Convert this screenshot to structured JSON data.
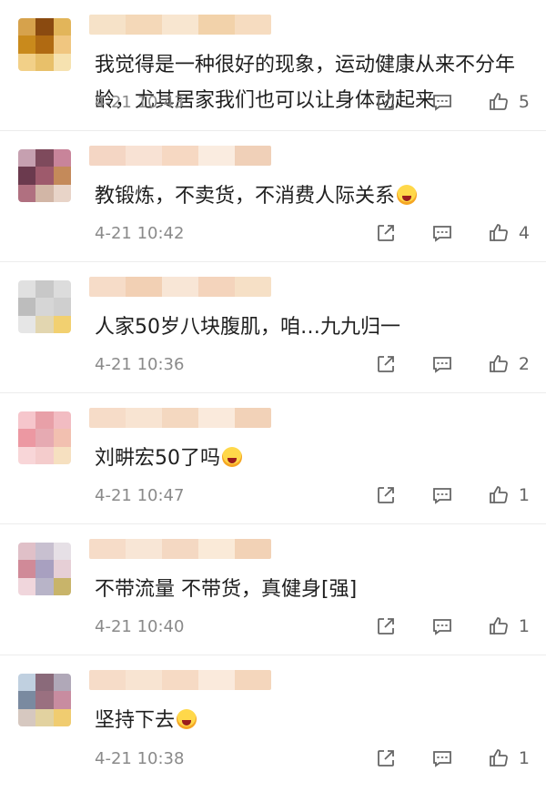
{
  "comments": [
    {
      "text": "我觉得是一种很好的现象，运动健康从来不分年龄，尤其居家我们也可以让身体动起来",
      "time": "4-21 10:43",
      "likes": "5",
      "avatar_colors": [
        "#d6a24c",
        "#8a4a10",
        "#e2b55a",
        "#c98a1c",
        "#b06a12",
        "#f0c680",
        "#f2d088",
        "#e8c06a",
        "#f6e2b0"
      ],
      "name_colors": [
        "#f6e2c8",
        "#f4d8b8",
        "#f8e6d0",
        "#f2d2aa",
        "#f6dcc0"
      ],
      "emoji": null
    },
    {
      "text": "教锻炼，不卖货，不消费人际关系",
      "time": "4-21 10:42",
      "likes": "4",
      "avatar_colors": [
        "#c6a0b0",
        "#7e4a5c",
        "#c8849a",
        "#6b3a4e",
        "#9e5a6c",
        "#c48a5a",
        "#b07080",
        "#d2b6a6",
        "#e8d4c8"
      ],
      "name_colors": [
        "#f4d6c4",
        "#f8e2d4",
        "#f6d8c2",
        "#faece0",
        "#f0d0b8"
      ],
      "emoji": "laugh"
    },
    {
      "text": "人家50岁八块腹肌，咱…九九归一",
      "time": "4-21 10:36",
      "likes": "2",
      "avatar_colors": [
        "#e0e0e0",
        "#c8c8c8",
        "#dcdcdc",
        "#bdbdbd",
        "#d6d6d6",
        "#cfcfcf",
        "#e6e6e6",
        "#e2d6b0",
        "#f2d070"
      ],
      "name_colors": [
        "#f6dcc8",
        "#f2d0b4",
        "#f8e6d6",
        "#f4d4bc",
        "#f6e0c6"
      ],
      "emoji": null
    },
    {
      "text": "刘畊宏50了吗",
      "time": "4-21 10:47",
      "likes": "1",
      "avatar_colors": [
        "#f6c6cc",
        "#e8a0a8",
        "#f2bcc2",
        "#ec98a2",
        "#e6aab2",
        "#f2c0b0",
        "#f8d6d8",
        "#f4cccc",
        "#f6e0c0"
      ],
      "name_colors": [
        "#f6dcc8",
        "#f8e4d2",
        "#f4d8c0",
        "#faeadc",
        "#f2d2b8"
      ],
      "emoji": "laugh"
    },
    {
      "text": "不带流量 不带货，真健身[强]",
      "time": "4-21 10:40",
      "likes": "1",
      "avatar_colors": [
        "#e0c0c8",
        "#c8c0d0",
        "#e6e0e6",
        "#d08a98",
        "#a8a0c0",
        "#e6cfd6",
        "#f0d6dc",
        "#b8b4c8",
        "#c8b46a"
      ],
      "name_colors": [
        "#f6dcc8",
        "#f8e6d6",
        "#f4d8c2",
        "#faead8",
        "#f2d2b6"
      ],
      "emoji": null
    },
    {
      "text": "坚持下去",
      "time": "4-21 10:38",
      "likes": "1",
      "avatar_colors": [
        "#c0d0e0",
        "#8a6a7a",
        "#b0a8b8",
        "#7a8aa0",
        "#9a7080",
        "#c88ca0",
        "#d6c8c0",
        "#e2d2a0",
        "#f0cc70"
      ],
      "name_colors": [
        "#f6dcc8",
        "#f8e4d2",
        "#f6dac4",
        "#faeadc",
        "#f4d6bc"
      ],
      "emoji": "cat"
    }
  ]
}
